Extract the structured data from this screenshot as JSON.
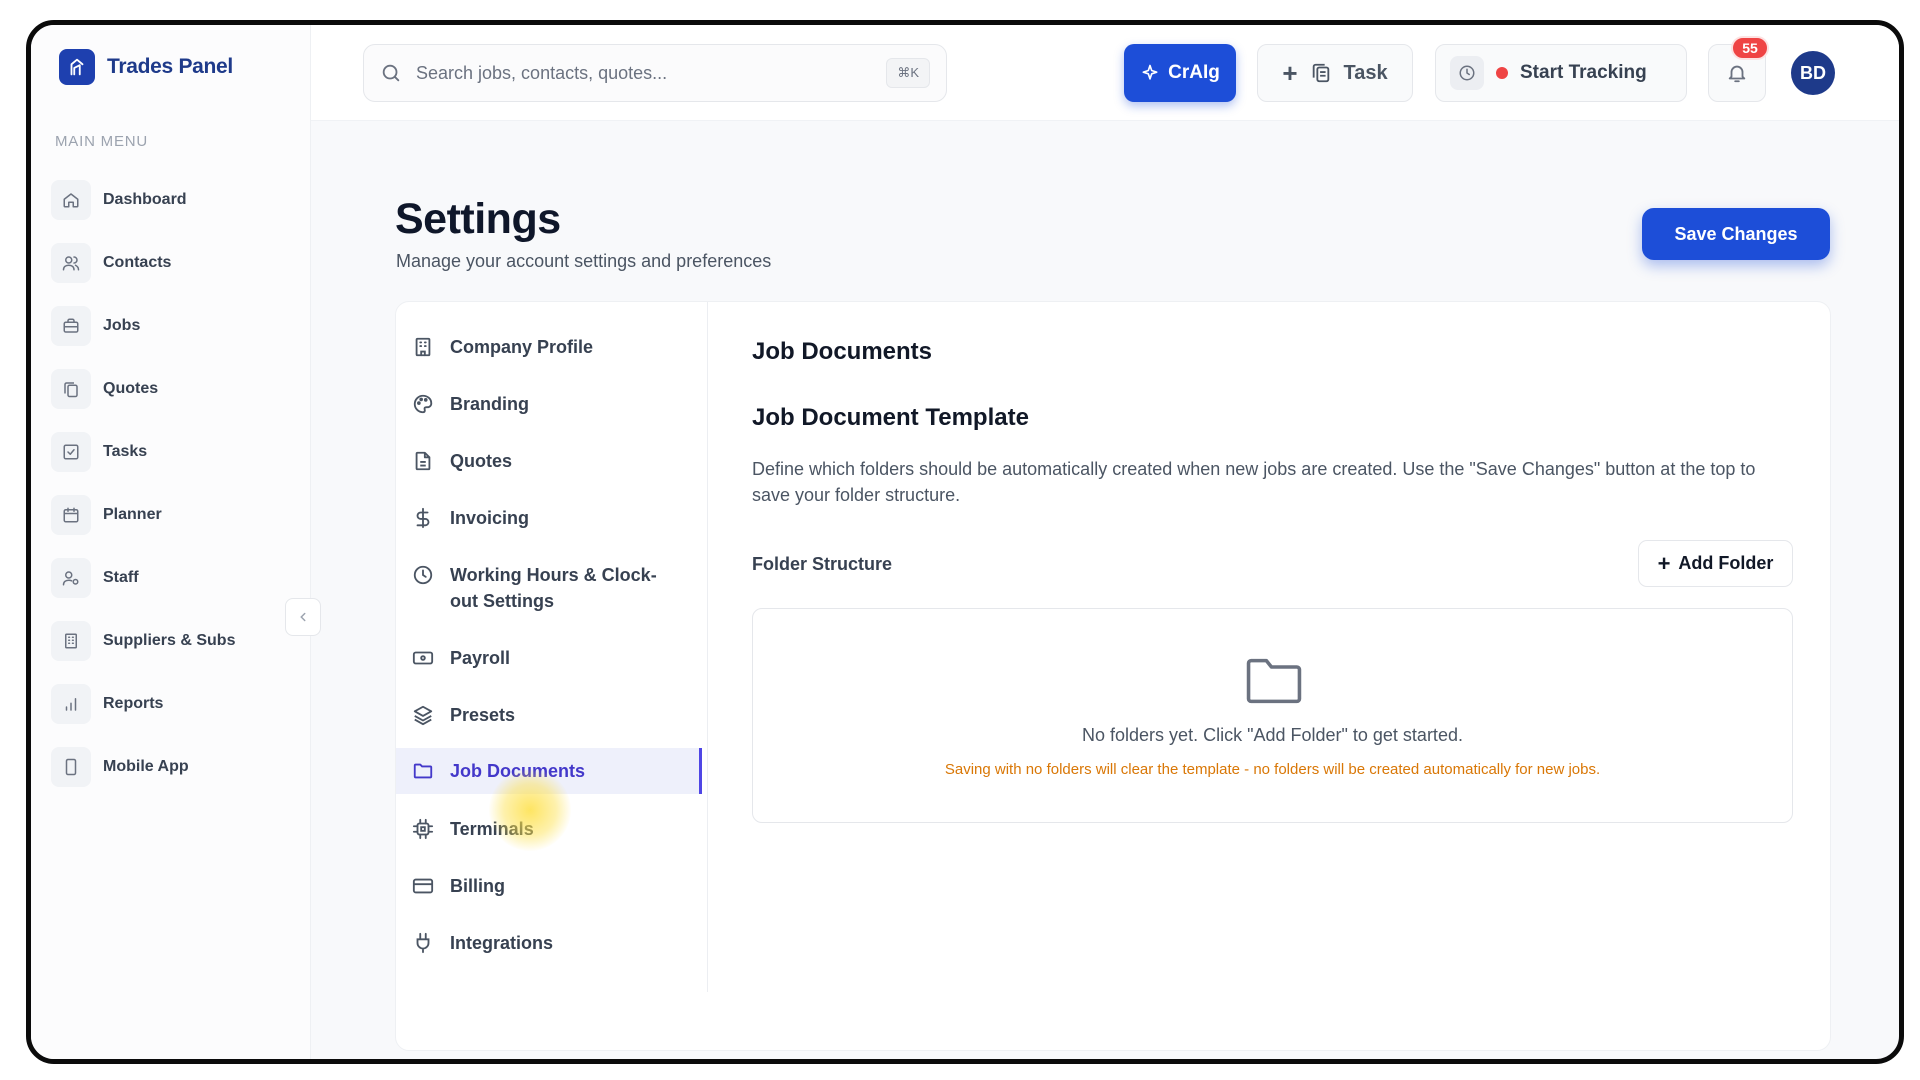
{
  "brand": {
    "name": "Trades Panel"
  },
  "sidebar": {
    "heading": "MAIN MENU",
    "items": [
      {
        "label": "Dashboard",
        "icon": "home-icon"
      },
      {
        "label": "Contacts",
        "icon": "users-icon"
      },
      {
        "label": "Jobs",
        "icon": "briefcase-icon"
      },
      {
        "label": "Quotes",
        "icon": "copy-document-icon"
      },
      {
        "label": "Tasks",
        "icon": "checkbox-icon"
      },
      {
        "label": "Planner",
        "icon": "calendar-icon"
      },
      {
        "label": "Staff",
        "icon": "user-cog-icon"
      },
      {
        "label": "Suppliers & Subs",
        "icon": "building-icon"
      },
      {
        "label": "Reports",
        "icon": "bar-chart-icon"
      },
      {
        "label": "Mobile App",
        "icon": "smartphone-icon"
      }
    ]
  },
  "topbar": {
    "search_placeholder": "Search jobs, contacts, quotes...",
    "search_shortcut": "⌘K",
    "craig_label": "CrAIg",
    "task_label": "Task",
    "tracking_label": "Start Tracking",
    "notifications_count": "55",
    "avatar_initials": "BD"
  },
  "page": {
    "title": "Settings",
    "subtitle": "Manage your account settings and preferences",
    "save_label": "Save Changes"
  },
  "settings_nav": {
    "items": [
      {
        "label": "Company Profile",
        "icon": "building-icon"
      },
      {
        "label": "Branding",
        "icon": "palette-icon"
      },
      {
        "label": "Quotes",
        "icon": "file-text-icon"
      },
      {
        "label": "Invoicing",
        "icon": "dollar-icon"
      },
      {
        "label": "Working Hours & Clock-out Settings",
        "icon": "clock-icon"
      },
      {
        "label": "Payroll",
        "icon": "banknote-icon"
      },
      {
        "label": "Presets",
        "icon": "layers-icon"
      },
      {
        "label": "Job Documents",
        "icon": "folder-icon",
        "active": true
      },
      {
        "label": "Terminals",
        "icon": "chip-icon"
      },
      {
        "label": "Billing",
        "icon": "credit-card-icon"
      },
      {
        "label": "Integrations",
        "icon": "plug-icon"
      }
    ]
  },
  "panel": {
    "title": "Job Documents",
    "section_title": "Job Document Template",
    "section_desc": "Define which folders should be automatically created when new jobs are created. Use the \"Save Changes\" button at the top to save your folder structure.",
    "folder_structure_label": "Folder Structure",
    "add_folder_label": "Add Folder",
    "empty_text": "No folders yet. Click \"Add Folder\" to get started.",
    "empty_warning": "Saving with no folders will clear the template - no folders will be created automatically for new jobs."
  },
  "colors": {
    "accent": "#1d4ed8",
    "active_nav": "#4338ca",
    "warning": "#d97706",
    "badge": "#ef4444"
  }
}
